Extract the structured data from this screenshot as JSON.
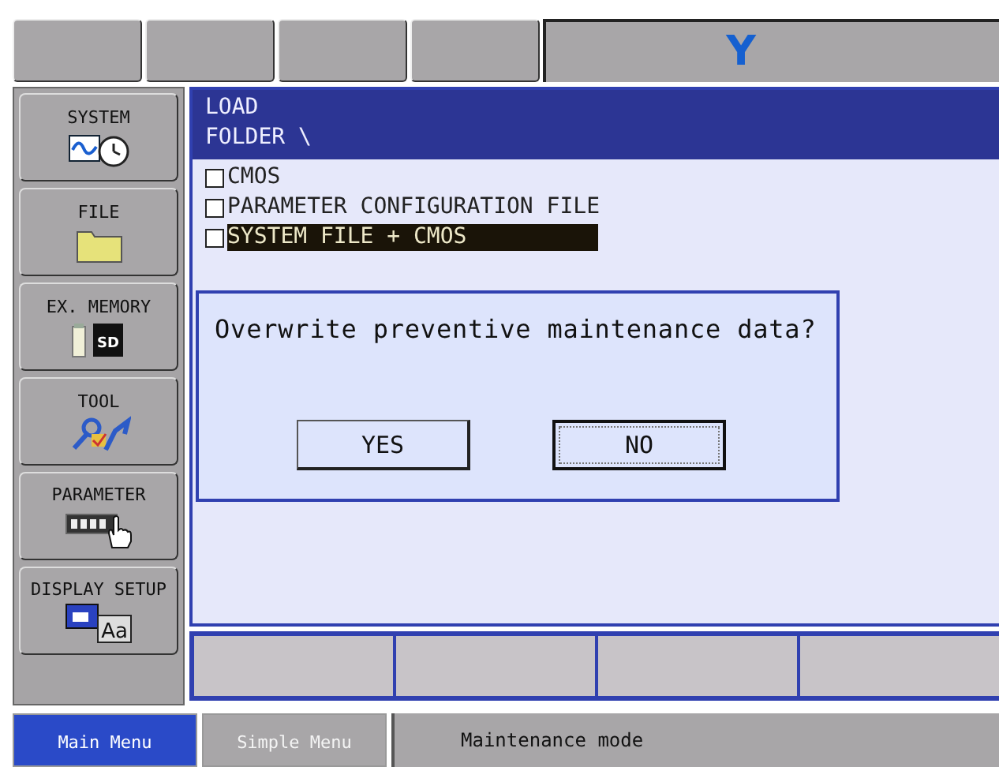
{
  "top_bar": {
    "axis_label": "Y"
  },
  "main_menu": [
    {
      "label": "SYSTEM",
      "kind": "system"
    },
    {
      "label": "FILE",
      "kind": "file"
    },
    {
      "label": "EX. MEMORY",
      "kind": "memory",
      "icon_text": "SD"
    },
    {
      "label": "TOOL",
      "kind": "tool"
    },
    {
      "label": "PARAMETER",
      "kind": "parameter"
    },
    {
      "label": "DISPLAY SETUP",
      "kind": "display",
      "icon_text": "Aa"
    }
  ],
  "content": {
    "title": "LOAD",
    "folder": "FOLDER \\",
    "items": [
      {
        "label": "CMOS",
        "checked": false,
        "selected": false
      },
      {
        "label": "PARAMETER CONFIGURATION FILE",
        "checked": false,
        "selected": false
      },
      {
        "label": "SYSTEM FILE + CMOS",
        "checked": false,
        "selected": true
      }
    ]
  },
  "dialog": {
    "message": "Overwrite preventive maintenance data?",
    "buttons": [
      {
        "label": "YES",
        "selected": false
      },
      {
        "label": "NO",
        "selected": true
      }
    ]
  },
  "bottom_bar": {
    "tabs": [
      {
        "label": "Main Menu",
        "selected": true
      },
      {
        "label": "Simple Menu",
        "selected": false
      }
    ],
    "mode": "Maintenance mode"
  }
}
